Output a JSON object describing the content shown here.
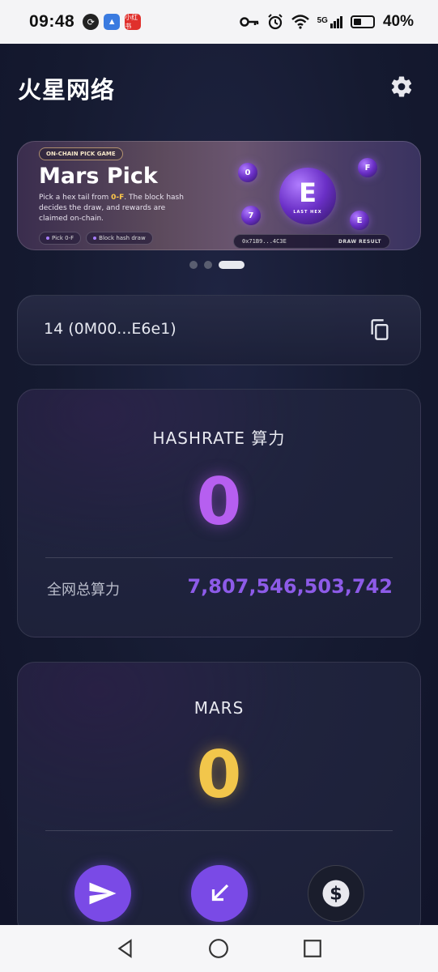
{
  "status_bar": {
    "time": "09:48",
    "left_icons": [
      "sync-icon",
      "app-icon",
      "red-app-icon"
    ],
    "red_app_label": "小红书",
    "right_icons": [
      "key-icon",
      "alarm-icon",
      "wifi-icon",
      "5g-signal-icon",
      "battery-icon"
    ],
    "network": "5G",
    "battery": "40%"
  },
  "header": {
    "title": "火星网络",
    "settings_icon": "gear-icon"
  },
  "banner": {
    "tag": "ON-CHAIN PICK GAME",
    "title": "Mars Pick",
    "desc_pre": "Pick a hex tail from ",
    "desc_highlight": "0-F",
    "desc_post": ". The block hash decides the draw, and rewards are claimed on-chain.",
    "chips": [
      "Pick 0-F",
      "Block hash draw"
    ],
    "big_orb": "E",
    "big_orb_caption": "LAST HEX",
    "orbs": [
      "0",
      "F",
      "7",
      "E"
    ],
    "hash": "0x71B9...4C3E",
    "draw_label": "DRAW RESULT",
    "carousel_pages": 3,
    "carousel_active": 3
  },
  "address": {
    "text": "14 (0M00...E6e1)",
    "copy_icon": "copy-icon"
  },
  "hashrate": {
    "title": "HASHRATE 算力",
    "value": "0",
    "network_label": "全网总算力",
    "network_value": "7,807,546,503,742"
  },
  "mars": {
    "title": "MARS",
    "value": "0",
    "actions": [
      "send-icon",
      "receive-icon",
      "dollar-icon"
    ]
  },
  "navbar": {
    "buttons": [
      "back-icon",
      "home-icon",
      "recents-icon"
    ]
  },
  "colors": {
    "accent_purple": "#b65ff0",
    "accent_gold": "#f2c64b",
    "button_purple": "#7a4ae6"
  }
}
